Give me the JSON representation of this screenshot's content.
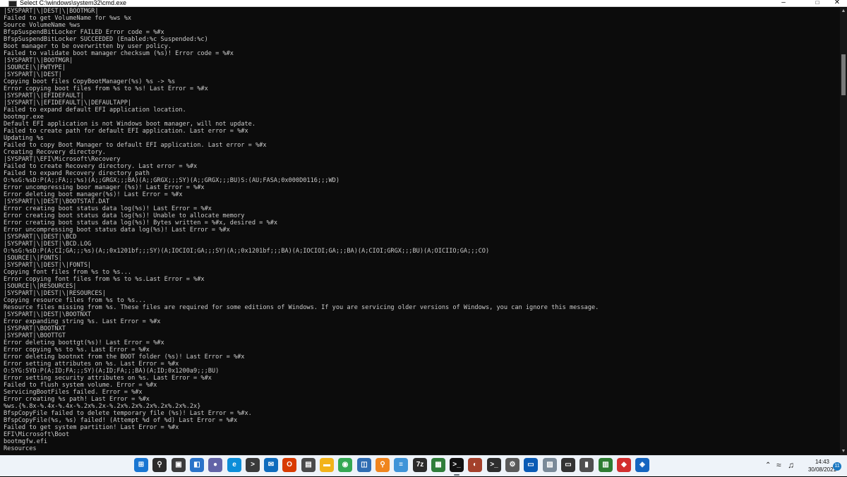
{
  "window": {
    "title": "Select C:\\windows\\system32\\cmd.exe",
    "icon": "console-icon",
    "controls": [
      "minimize-icon",
      "maximize-icon",
      "close-icon"
    ]
  },
  "console": {
    "background": "#0c0c0c",
    "foreground": "#cccccc",
    "lines": [
      "|SYSPART|\\|DEST|\\|BOOTMGR|",
      "Failed to get VolumeName for %ws %x",
      "Source VolumeName %ws",
      "BfspSuspendBitLocker FAILED Error code = %#x",
      "BfspSuspendBitLocker SUCCEEDED (Enabled:%c Suspended:%c)",
      "Boot manager to be overwritten by user policy.",
      "Failed to validate boot manager checksum (%s)! Error code = %#x",
      "|SYSPART|\\|BOOTMGR|",
      "|SOURCE|\\|FWTYPE|",
      "|SYSPART|\\|DEST|",
      "Copying boot files CopyBootManager(%s) %s -> %s",
      "Error copying boot files from %s to %s! Last Error = %#x",
      "|SYSPART|\\|EFIDEFAULT|",
      "|SYSPART|\\|EFIDEFAULT|\\|DEFAULTAPP|",
      "Failed to expand default EFI application location.",
      "bootmgr.exe",
      "Default EFI application is not Windows boot manager, will not update.",
      "Failed to create path for default EFI application. Last error = %#x",
      "Updating %s",
      "Failed to copy Boot Manager to default EFI application. Last error = %#x",
      "Creating Recovery directory.",
      "|SYSPART|\\EFI\\Microsoft\\Recovery",
      "Failed to create Recovery directory. Last error = %#x",
      "Failed to expand Recovery directory path",
      "O:%sG:%sD:P(A;;FA;;;%s)(A;;GRGX;;;BA)(A;;GRGX;;;SY)(A;;GRGX;;;BU)S:(AU;FASA;0x000D0116;;;WD)",
      "Error uncompressing boor manager (%s)! Last Error = %#x",
      "Error deleting boot manager(%s)! Last Error = %#x",
      "|SYSPART|\\|DEST|\\BOOTSTAT.DAT",
      "Error creating boot status data log(%s)! Last Error = %#x",
      "Error creating boot status data log(%s)! Unable to allocate memory",
      "Error creating boot status data log(%s)! Bytes written = %#x, desired = %#x",
      "Error uncompressing boot status data log(%s)! Last Error = %#x",
      "|SYSPART|\\|DEST|\\BCD",
      "|SYSPART|\\|DEST|\\BCD.LOG",
      "O:%sG:%sD:P(A;CI;GA;;;%s)(A;;0x1201bf;;;SY)(A;IOCIOI;GA;;;SY)(A;;0x1201bf;;;BA)(A;IOCIOI;GA;;;BA)(A;CIOI;GRGX;;;BU)(A;OICIIO;GA;;;CO)",
      "|SOURCE|\\|FONTS|",
      "|SYSPART|\\|DEST|\\|FONTS|",
      "Copying font files from %s to %s...",
      "Error copying font files from %s to %s.Last Error = %#x",
      "|SOURCE|\\|RESOURCES|",
      "|SYSPART|\\|DEST|\\|RESOURCES|",
      "Copying resource files from %s to %s...",
      "Resource files missing from %s. These files are required for some editions of Windows. If you are servicing older versions of Windows, you can ignore this message.",
      "|SYSPART|\\|DEST|\\BOOTNXT",
      "Error expanding string %s. Last Error = %#x",
      "|SYSPART|\\BOOTNXT",
      "|SYSPART|\\BOOTTGT",
      "Error deleting boottgt(%s)! Last Error = %#x",
      "Error copying %s to %s. Last Error = %#x",
      "Error deleting bootnxt from the BOOT folder (%s)! Last Error = %#x",
      "Error setting attributes on %s. Last Error = %#x",
      "O:SYG:SYD:P(A;ID;FA;;;SY)(A;ID;FA;;;BA)(A;ID;0x1200a9;;;BU)",
      "Error setting security attributes on %s. Last Error = %#x",
      "Failed to flush system volume. Error = %#x",
      "ServicingBootFiles failed. Error = %#x",
      "Error creating %s path! Last Error = %#x",
      "%ws.{%.8x-%.4x-%.4x-%.2x%.2x-%.2x%.2x%.2x%.2x%.2x%.2x}",
      "BfspCopyFile failed to delete temporary file (%s)! Last Error = %#x.",
      "BfspCopyFile(%s, %s) failed! (Attempt %d of %d) Last Error = %#x",
      "Failed to get system partition! Last Error = %#x",
      "EFI\\Microsoft\\Boot",
      "bootmgfw.efi",
      "Resources"
    ]
  },
  "scrollbar": {
    "position_fraction": 0.1
  },
  "taskbar": {
    "background": "#eef3f9",
    "apps": [
      {
        "name": "start-icon",
        "glyph": "⊞",
        "color": "#1976d2",
        "active": false
      },
      {
        "name": "search-icon",
        "glyph": "⚲",
        "color": "#2b2b2b",
        "active": false
      },
      {
        "name": "task-view-icon",
        "glyph": "▣",
        "color": "#3b3b3b",
        "active": false
      },
      {
        "name": "widgets-icon",
        "glyph": "◧",
        "color": "#2a73c9",
        "active": false
      },
      {
        "name": "teams-chat-icon",
        "glyph": "●",
        "color": "#6264a7",
        "active": false
      },
      {
        "name": "edge-icon",
        "glyph": "e",
        "color": "#0c8ed9",
        "active": false
      },
      {
        "name": "terminal-icon",
        "glyph": ">",
        "color": "#3a3a3a",
        "active": false
      },
      {
        "name": "mail-icon",
        "glyph": "✉",
        "color": "#0f6cbd",
        "active": false
      },
      {
        "name": "office-icon",
        "glyph": "O",
        "color": "#d83b01",
        "active": false
      },
      {
        "name": "store-icon",
        "glyph": "▤",
        "color": "#4a4a4a",
        "active": false
      },
      {
        "name": "file-explorer-icon",
        "glyph": "▬",
        "color": "#f2b31a",
        "active": false
      },
      {
        "name": "chrome-icon",
        "glyph": "◉",
        "color": "#34a853",
        "active": false
      },
      {
        "name": "network-monitor-icon",
        "glyph": "◫",
        "color": "#2f6db3",
        "active": false
      },
      {
        "name": "magnifier-icon",
        "glyph": "⚲",
        "color": "#f0851d",
        "active": false
      },
      {
        "name": "notepad-icon",
        "glyph": "≡",
        "color": "#3f94d8",
        "active": false
      },
      {
        "name": "7zip-icon",
        "glyph": "7z",
        "color": "#2b2b2b",
        "active": false
      },
      {
        "name": "task-manager-icon",
        "glyph": "▦",
        "color": "#2f7d3a",
        "active": false
      },
      {
        "name": "cmd-icon",
        "glyph": ">_",
        "color": "#111111",
        "active": true
      },
      {
        "name": "photo-app-icon",
        "glyph": "◐",
        "color": "#a4412c",
        "active": false
      },
      {
        "name": "console-app-icon",
        "glyph": ">_",
        "color": "#2d2d2d",
        "active": false
      },
      {
        "name": "settings-icon",
        "glyph": "⚙",
        "color": "#5a5a5a",
        "active": false
      },
      {
        "name": "remote-desktop-icon",
        "glyph": "▭",
        "color": "#0a5bb5",
        "active": false
      },
      {
        "name": "image-viewer-icon",
        "glyph": "▨",
        "color": "#7a8a99",
        "active": false
      },
      {
        "name": "monitor-app-icon",
        "glyph": "▭",
        "color": "#333333",
        "active": false
      },
      {
        "name": "disk-tool-icon",
        "glyph": "▮",
        "color": "#4f4f4f",
        "active": false
      },
      {
        "name": "chart-app-icon",
        "glyph": "▥",
        "color": "#2e7d32",
        "active": false
      },
      {
        "name": "red-app-icon",
        "glyph": "◆",
        "color": "#d32f2f",
        "active": false
      },
      {
        "name": "virtualbox-icon",
        "glyph": "◈",
        "color": "#1565c0",
        "active": false
      }
    ]
  },
  "tray": {
    "icons": [
      "chevron-up-icon",
      "wifi-icon",
      "volume-icon"
    ],
    "time": "14:43",
    "date": "30/08/2021",
    "notification_count": "11"
  }
}
